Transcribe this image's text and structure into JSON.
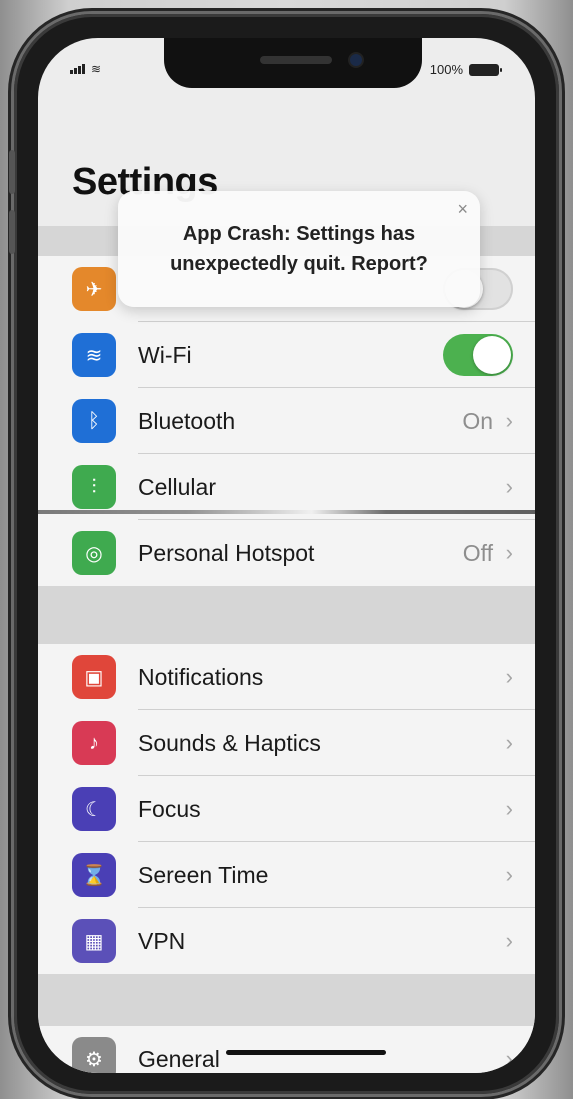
{
  "status_bar": {
    "battery": "100%"
  },
  "page_title": "Settings",
  "alert": {
    "line1": "App Crash: Settings has",
    "line2": "unexpectedly quit. Report?",
    "close_glyph": "×"
  },
  "groups": {
    "connectivity": [
      {
        "label": "",
        "icon": "airplane-icon",
        "color": "#e4882b",
        "glyph": "✈",
        "control": "toggle-off"
      },
      {
        "label": "Wi-Fi",
        "icon": "wifi-icon",
        "color": "#1f6fd6",
        "glyph": "≋",
        "control": "toggle-on"
      },
      {
        "label": "Bluetooth",
        "icon": "bluetooth-icon",
        "color": "#1f6fd6",
        "glyph": "ᛒ",
        "value": "On",
        "control": "chevron"
      },
      {
        "label": "Cellular",
        "icon": "cellular-icon",
        "color": "#3faa4f",
        "glyph": "⫶",
        "control": "chevron"
      },
      {
        "label": "Personal Hotspot",
        "icon": "hotspot-icon",
        "color": "#3faa4f",
        "glyph": "◎",
        "value": "Off",
        "control": "chevron"
      }
    ],
    "notifications": [
      {
        "label": "Notifications",
        "icon": "notifications-icon",
        "color": "#e0463a",
        "glyph": "▣"
      },
      {
        "label": "Sounds & Haptics",
        "icon": "sounds-icon",
        "color": "#d83a55",
        "glyph": "♪"
      },
      {
        "label": "Focus",
        "icon": "focus-moon-icon",
        "color": "#4a3fb5",
        "glyph": "☾"
      },
      {
        "label": "Sereen Time",
        "icon": "screen-time-icon",
        "color": "#4a3fb5",
        "glyph": "⌛"
      },
      {
        "label": "VPN",
        "icon": "vpn-icon",
        "color": "#5b50b8",
        "glyph": "▦"
      }
    ],
    "general": [
      {
        "label": "General",
        "icon": "gear-icon",
        "color": "#8a8a8a",
        "glyph": "⚙"
      }
    ]
  },
  "chevron_glyph": "›"
}
